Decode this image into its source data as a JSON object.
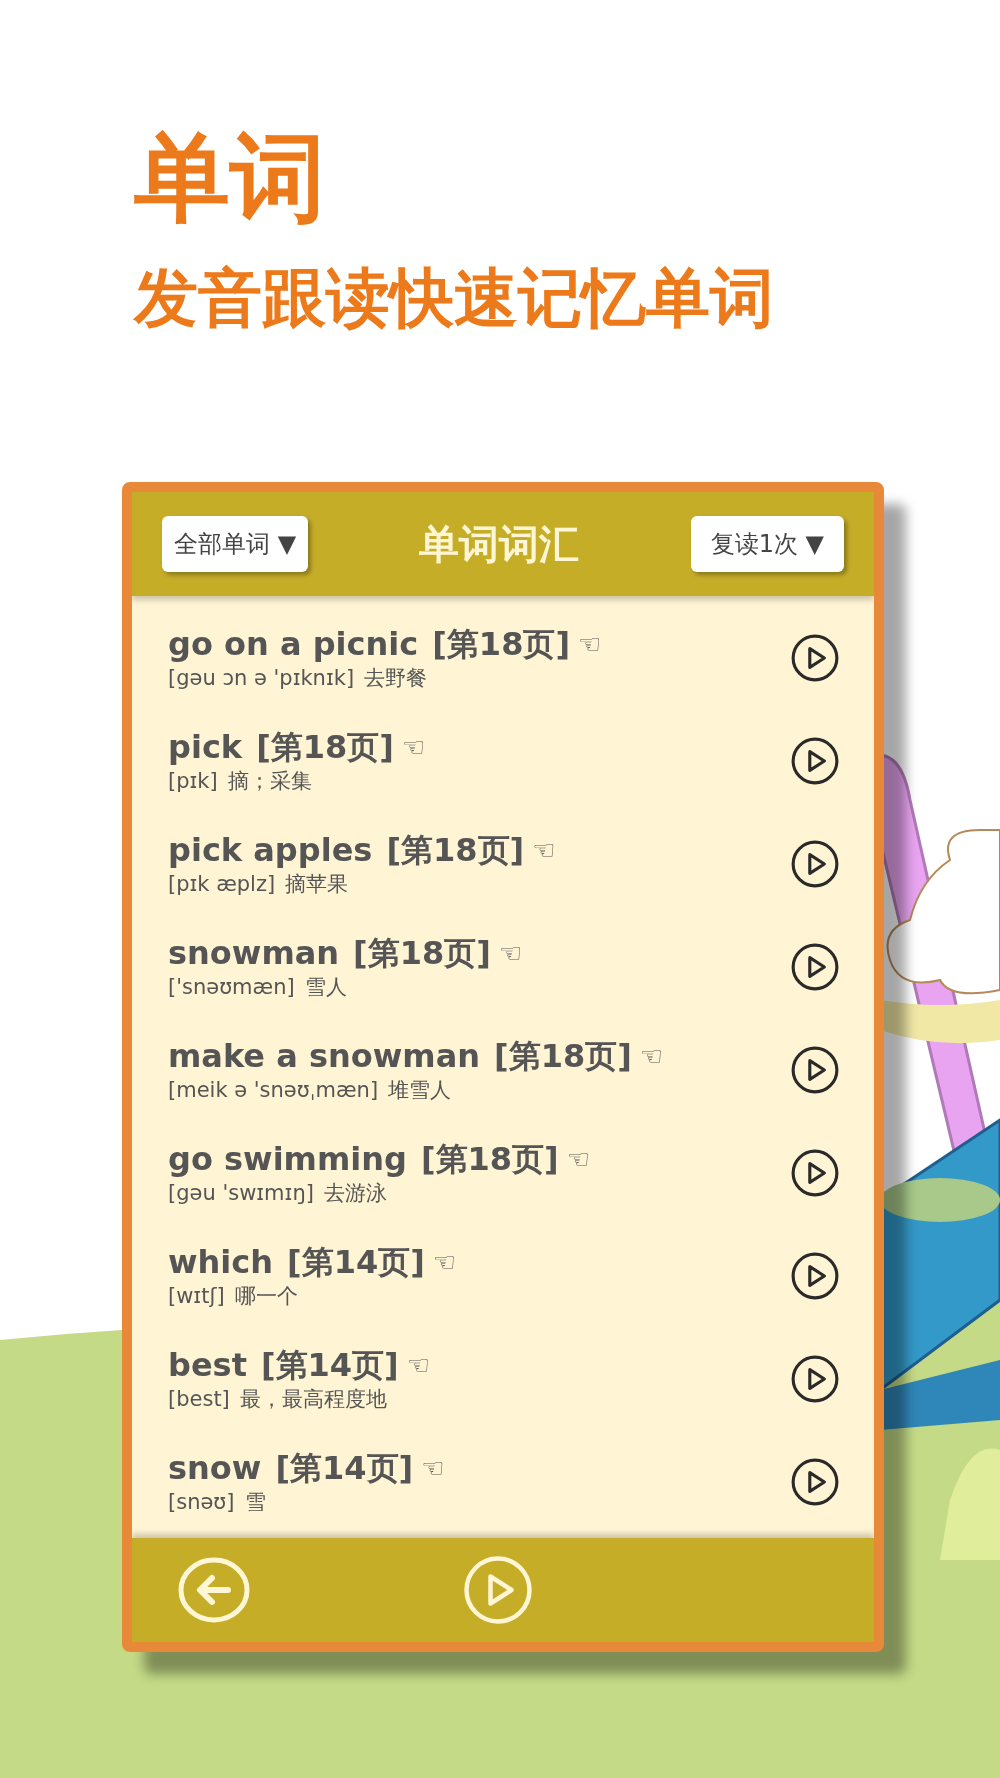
{
  "headline": "单词",
  "tagline": "发音跟读快速记忆单词",
  "header": {
    "filter": "全部单词 ▼",
    "title": "单词词汇",
    "repeat": "复读1次 ▼"
  },
  "words": [
    {
      "word": "go on a picnic",
      "page": "[第18页]",
      "pointer": "☜",
      "phonetic": "[gəu ɔn ə 'pɪknɪk]",
      "meaning": "去野餐"
    },
    {
      "word": "pick",
      "page": "[第18页]",
      "pointer": "☜",
      "phonetic": "[pɪk]",
      "meaning": "摘；采集"
    },
    {
      "word": "pick apples",
      "page": "[第18页]",
      "pointer": "☜",
      "phonetic": "[pɪk æplz]",
      "meaning": "摘苹果"
    },
    {
      "word": "snowman",
      "page": "[第18页]",
      "pointer": "☜",
      "phonetic": "['snəʊmæn]",
      "meaning": "雪人"
    },
    {
      "word": "make a snowman",
      "page": "[第18页]",
      "pointer": "☜",
      "phonetic": "[meik ə 'snəʊˌmæn]",
      "meaning": "堆雪人"
    },
    {
      "word": "go swimming",
      "page": "[第18页]",
      "pointer": "☜",
      "phonetic": "[gəu 'swɪmɪŋ]",
      "meaning": "去游泳"
    },
    {
      "word": "which",
      "page": "[第14页]",
      "pointer": "☜",
      "phonetic": "[wɪtʃ]",
      "meaning": "哪一个"
    },
    {
      "word": "best",
      "page": "[第14页]",
      "pointer": "☜",
      "phonetic": "[best]",
      "meaning": "最，最高程度地"
    },
    {
      "word": "snow",
      "page": "[第14页]",
      "pointer": "☜",
      "phonetic": "[snəʊ]",
      "meaning": "雪"
    }
  ]
}
